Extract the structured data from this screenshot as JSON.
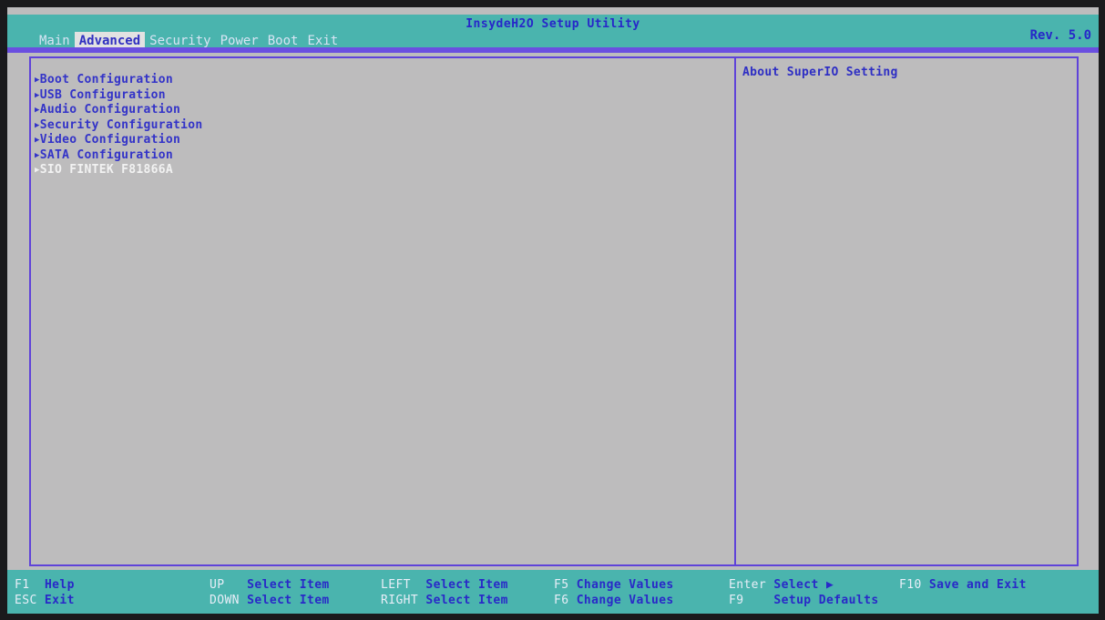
{
  "header": {
    "title": "InsydeH2O Setup Utility",
    "revision": "Rev. 5.0",
    "tabs": [
      "Main",
      "Advanced",
      "Security",
      "Power",
      "Boot",
      "Exit"
    ],
    "active_tab": "Advanced"
  },
  "menu": {
    "items": [
      "Boot Configuration",
      "USB Configuration",
      "Audio Configuration",
      "Security Configuration",
      "Video Configuration",
      "SATA Configuration",
      "SIO FINTEK F81866A"
    ],
    "selected": "SIO FINTEK F81866A",
    "arrow": "▶"
  },
  "help": {
    "text": "About SuperIO Setting"
  },
  "footer": {
    "hints": [
      {
        "key": "F1",
        "desc": "Help"
      },
      {
        "key": "ESC",
        "desc": "Exit"
      },
      {
        "key": "UP",
        "desc": "Select Item"
      },
      {
        "key": "DOWN",
        "desc": "Select Item"
      },
      {
        "key": "LEFT",
        "desc": "Select Item"
      },
      {
        "key": "RIGHT",
        "desc": "Select Item"
      },
      {
        "key": "F5",
        "desc": "Change Values"
      },
      {
        "key": "F6",
        "desc": "Change Values"
      },
      {
        "key": "Enter",
        "desc": "Select ▶"
      },
      {
        "key": "F9",
        "desc": "Setup Defaults"
      },
      {
        "key": "F10",
        "desc": "Save and Exit"
      }
    ]
  },
  "colors": {
    "bar": "#4ab4ae",
    "panel_bg": "#bdbcbd",
    "accent_text": "#3333c8",
    "border": "#5f43d9",
    "selected_text": "#f2f2f2"
  }
}
